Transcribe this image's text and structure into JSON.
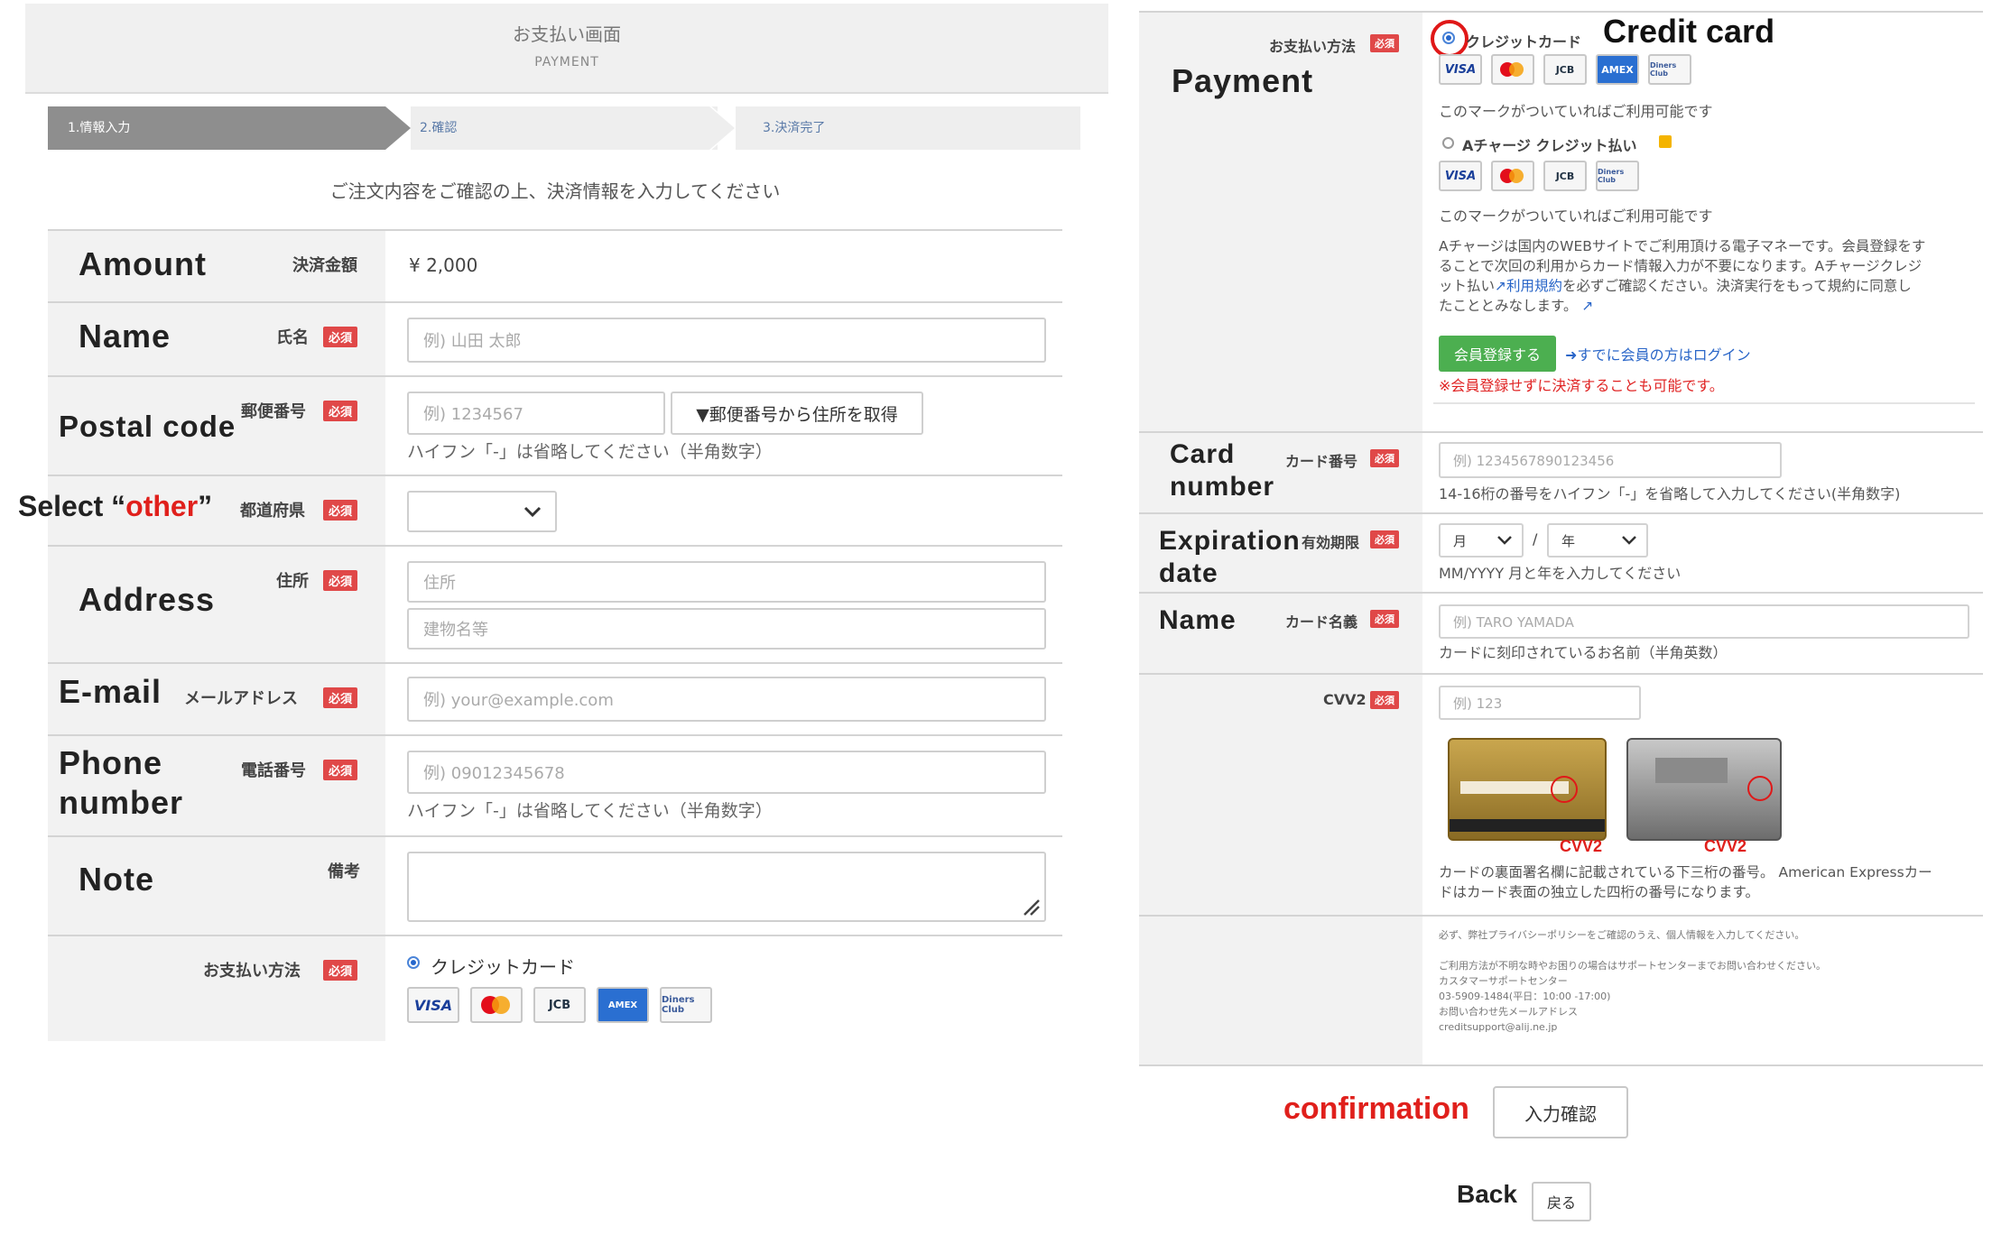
{
  "left": {
    "header": {
      "title": "お支払い画面",
      "subtitle": "PAYMENT"
    },
    "steps": [
      {
        "label": "1.情報入力"
      },
      {
        "label": "2.確認"
      },
      {
        "label": "3.決済完了"
      }
    ],
    "intro": "ご注文内容をご確認の上、決済情報を入力してください",
    "required_badge": "必須",
    "amount": {
      "en": "Amount",
      "jp": "決済金額",
      "value": "¥ 2,000"
    },
    "name": {
      "en": "Name",
      "jp": "氏名",
      "placeholder": "例) 山田 太郎"
    },
    "postal": {
      "en": "Postal code",
      "jp": "郵便番号",
      "placeholder": "例) 1234567",
      "button": "▼郵便番号から住所を取得",
      "hint": "ハイフン「-」は省略してください（半角数字）"
    },
    "prefecture": {
      "en_pre": "Select “",
      "en_other": "other",
      "en_post": "”",
      "jp": "都道府県"
    },
    "address": {
      "en": "Address",
      "jp": "住所",
      "placeholder1": "住所",
      "placeholder2": "建物名等"
    },
    "email": {
      "en": "E-mail",
      "jp": "メールアドレス",
      "placeholder": "例) your@example.com"
    },
    "phone": {
      "en1": "Phone",
      "en2": "number",
      "jp": "電話番号",
      "placeholder": "例) 09012345678",
      "hint": "ハイフン「-」は省略してください（半角数字）"
    },
    "note": {
      "en": "Note",
      "jp": "備考"
    },
    "payment": {
      "jp": "お支払い方法",
      "option": "クレジットカード"
    }
  },
  "cards": {
    "visa": "VISA",
    "jcb": "JCB",
    "amex": "AMEX",
    "diners": "Diners Club"
  },
  "right": {
    "payment": {
      "en": "Payment",
      "jp": "お支払い方法",
      "callout": "Credit card",
      "option1": "クレジットカード",
      "mark_note1": "このマークがついていればご利用可能です",
      "option2": "Aチャージ クレジット払い",
      "mark_note2": "このマークがついていればご利用可能です",
      "desc_line1": "Aチャージは国内のWEBサイトでご利用頂ける電子マネーです。会員登録をす",
      "desc_line2": "ることで次回の利用からカード情報入力が不要になります。Aチャージクレジ",
      "desc_line3a": "ット払い",
      "desc_link": "利用規約",
      "desc_line3b": "を必ずご確認ください。決済実行をもって規約に同意し",
      "desc_line4": "たこととみなします。",
      "register_button": "会員登録する",
      "login_link": "すでに会員の方はログイン",
      "warning": "※会員登録せずに決済することも可能です。"
    },
    "card_number": {
      "en1": "Card",
      "en2": "number",
      "jp": "カード番号",
      "placeholder": "例) 1234567890123456",
      "hint": "14-16桁の番号をハイフン「-」を省略して入力してください(半角数字)"
    },
    "expiry": {
      "en1": "Expiration",
      "en2": "date",
      "jp": "有効期限",
      "month": "月",
      "sep": "/",
      "year": "年",
      "hint": "MM/YYYY 月と年を入力してください"
    },
    "card_name": {
      "en": "Name",
      "jp": "カード名義",
      "placeholder": "例) TARO YAMADA",
      "hint": "カードに刻印されているお名前（半角英数）"
    },
    "cvv": {
      "jp": "CVV2",
      "placeholder": "例) 123",
      "label_a": "CVV2",
      "label_b": "CVV2",
      "desc1": "カードの裏面署名欄に記載されている下三桁の番号。 American Expressカー",
      "desc2": "ドはカード表面の独立した四桁の番号になります。"
    },
    "footer": {
      "privacy": "必ず、弊社プライバシーポリシーをご確認のうえ、個人情報を入力してください。",
      "support1": "ご利用方法が不明な時やお困りの場合はサポートセンターまでお問い合わせください。",
      "support2": "カスタマーサポートセンター",
      "support3": "03-5909-1484(平日：10:00 -17:00)",
      "support4": "お問い合わせ先メールアドレス",
      "support5": "creditsupport@alij.ne.jp"
    },
    "confirm": {
      "en": "confirmation",
      "button": "入力確認"
    },
    "back": {
      "en": "Back",
      "button": "戻る"
    }
  }
}
